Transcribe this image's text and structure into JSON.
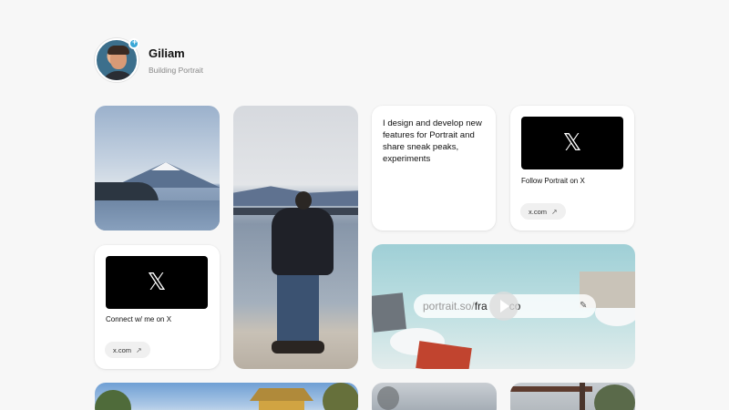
{
  "profile": {
    "name": "Giliam",
    "subtitle": "Building Portrait"
  },
  "cards": {
    "text_card": "I design and develop new features for Portrait and share sneak peaks, experiments",
    "x_follow": {
      "icon": "x-logo-icon",
      "glyph": "𝕏",
      "label": "Follow Portrait on X",
      "link": "x.com"
    },
    "x_connect": {
      "icon": "x-logo-icon",
      "glyph": "𝕏",
      "label": "Connect w/ me on X",
      "link": "x.com"
    },
    "video": {
      "url_prefix": "portrait.so/",
      "url_slug": "fra",
      "url_suffix": "co"
    }
  },
  "colors": {
    "background": "#f7f7f7",
    "x_box": "#000000",
    "pill": "#f0f0f0",
    "badge": "#39a7d6"
  }
}
